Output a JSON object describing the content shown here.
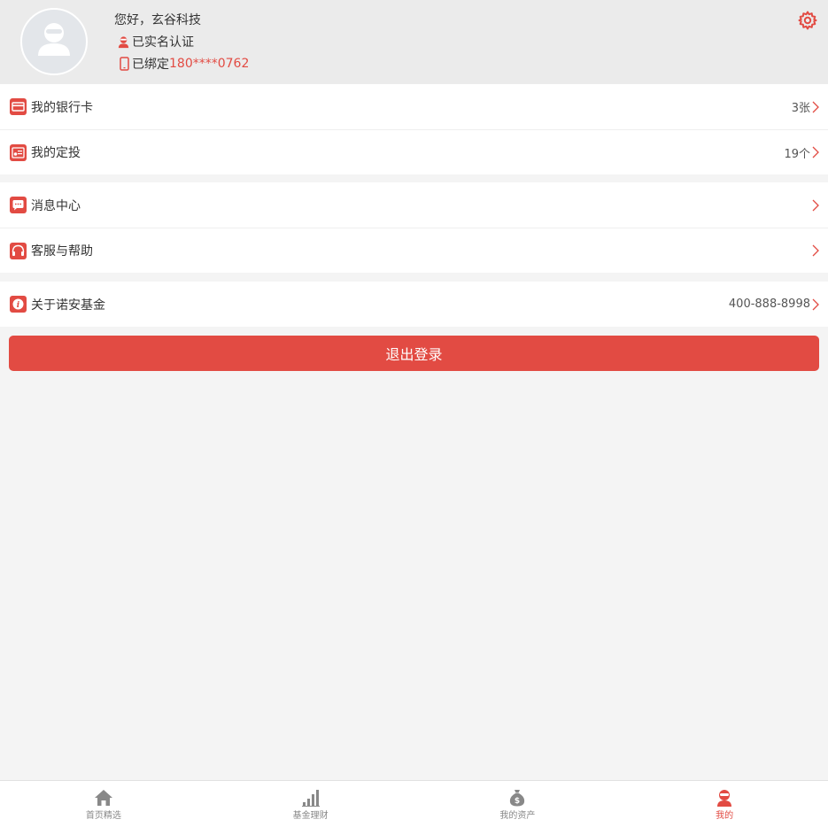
{
  "profile": {
    "greeting": "您好，玄谷科技",
    "verified_label": "已实名认证",
    "phone_prefix": "已绑定",
    "phone_number": "180****0762"
  },
  "menu": {
    "bank_cards": {
      "label": "我的银行卡",
      "value": "3张"
    },
    "fixed_invest": {
      "label": "我的定投",
      "value": "19个"
    },
    "messages": {
      "label": "消息中心"
    },
    "support": {
      "label": "客服与帮助"
    },
    "about": {
      "label": "关于诺安基金",
      "value": "400-888-8998"
    }
  },
  "logout_label": "退出登录",
  "tabs": [
    {
      "label": "首页精选",
      "icon": "home-icon",
      "active": false
    },
    {
      "label": "基金理财",
      "icon": "bar-chart-icon",
      "active": false
    },
    {
      "label": "我的资产",
      "icon": "money-bag-icon",
      "active": false
    },
    {
      "label": "我的",
      "icon": "user-icon",
      "active": true
    }
  ],
  "colors": {
    "accent": "#e24b43",
    "header_bg": "#ebebeb",
    "page_bg": "#f4f4f4",
    "tab_inactive": "#888888"
  }
}
